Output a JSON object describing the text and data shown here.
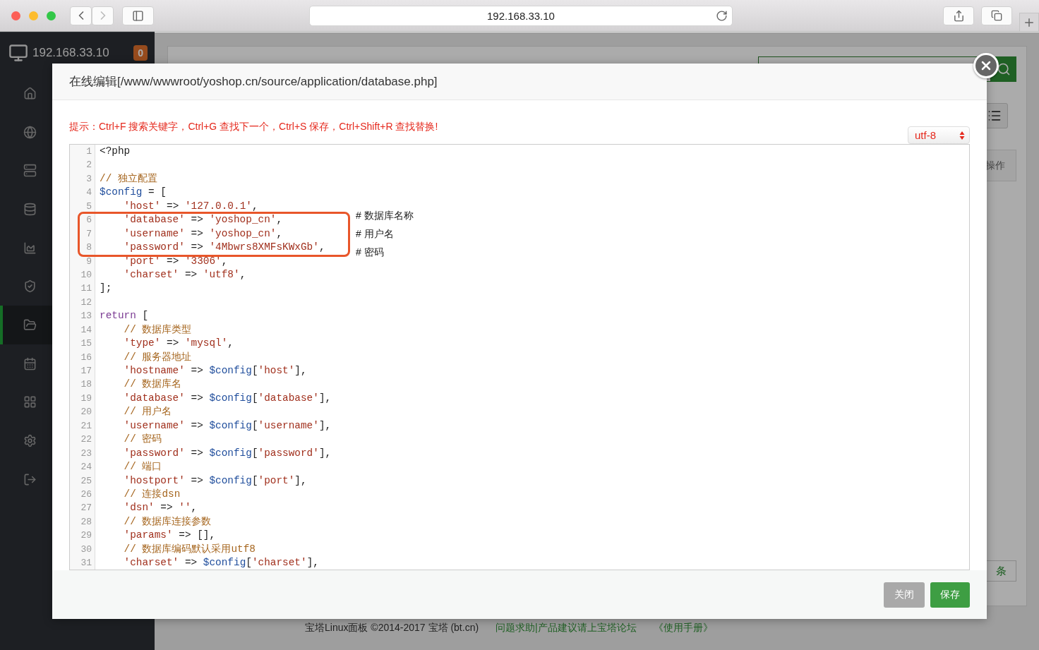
{
  "browser": {
    "url": "192.168.33.10"
  },
  "sidebar": {
    "host": "192.168.33.10",
    "badge": "0",
    "items": [
      {
        "selected": false
      },
      {
        "selected": false
      },
      {
        "selected": false
      },
      {
        "selected": false
      },
      {
        "selected": false
      },
      {
        "selected": false
      },
      {
        "selected": true
      },
      {
        "selected": false
      },
      {
        "selected": false
      },
      {
        "selected": false
      },
      {
        "selected": false
      }
    ]
  },
  "backdrop": {
    "table_header": "操作",
    "pager_button": "条"
  },
  "footer": {
    "copyright": "宝塔Linux面板 ©2014-2017 宝塔 (bt.cn)",
    "links": [
      "问题求助|产品建议请上宝塔论坛",
      "《使用手册》"
    ]
  },
  "dialog": {
    "title": "在线编辑[/www/wwwroot/yoshop.cn/source/application/database.php]",
    "hint": "提示：Ctrl+F 搜索关键字，Ctrl+G 查找下一个，Ctrl+S 保存，Ctrl+Shift+R 查找替换!",
    "encoding": "utf-8",
    "lines": [
      {
        "n": "1",
        "tokens": [
          {
            "kind": "plain",
            "text": "<?php"
          }
        ]
      },
      {
        "n": "2"
      },
      {
        "n": "3",
        "tokens": [
          {
            "kind": "comment",
            "text": "// 独立配置"
          }
        ]
      },
      {
        "n": "4",
        "tokens": [
          {
            "kind": "variable",
            "text": "$config"
          },
          {
            "kind": "plain",
            "text": " = ["
          }
        ]
      },
      {
        "n": "5",
        "indented": true,
        "tokens": [
          {
            "kind": "string",
            "text": "'host'"
          },
          {
            "kind": "plain",
            "text": " => "
          },
          {
            "kind": "string",
            "text": "'127.0.0.1'"
          },
          {
            "kind": "plain",
            "text": ","
          }
        ]
      },
      {
        "n": "6",
        "indented": true,
        "marked": true,
        "tokens": [
          {
            "kind": "string",
            "text": "'database'"
          },
          {
            "kind": "plain",
            "text": " => "
          },
          {
            "kind": "string",
            "text": "'yoshop_cn'"
          },
          {
            "kind": "plain",
            "text": ","
          }
        ]
      },
      {
        "n": "7",
        "indented": true,
        "marked": true,
        "tokens": [
          {
            "kind": "string",
            "text": "'username'"
          },
          {
            "kind": "plain",
            "text": " => "
          },
          {
            "kind": "string",
            "text": "'yoshop_cn'"
          },
          {
            "kind": "plain",
            "text": ","
          }
        ]
      },
      {
        "n": "8",
        "indented": true,
        "marked": true,
        "tokens": [
          {
            "kind": "string",
            "text": "'password'"
          },
          {
            "kind": "plain",
            "text": " => "
          },
          {
            "kind": "string",
            "text": "'4Mbwrs8XMFsKWxGb'"
          },
          {
            "kind": "plain",
            "text": ","
          }
        ]
      },
      {
        "n": "9",
        "indented": true,
        "tokens": [
          {
            "kind": "string",
            "text": "'port'"
          },
          {
            "kind": "plain",
            "text": " => "
          },
          {
            "kind": "string",
            "text": "'3306'"
          },
          {
            "kind": "plain",
            "text": ","
          }
        ]
      },
      {
        "n": "10",
        "indented": true,
        "tokens": [
          {
            "kind": "string",
            "text": "'charset'"
          },
          {
            "kind": "plain",
            "text": " => "
          },
          {
            "kind": "string",
            "text": "'utf8'"
          },
          {
            "kind": "plain",
            "text": ","
          }
        ]
      },
      {
        "n": "11",
        "tokens": [
          {
            "kind": "plain",
            "text": "];"
          }
        ]
      },
      {
        "n": "12"
      },
      {
        "n": "13",
        "tokens": [
          {
            "kind": "keyword",
            "text": "return"
          },
          {
            "kind": "plain",
            "text": " ["
          }
        ]
      },
      {
        "n": "14",
        "indented": true,
        "tokens": [
          {
            "kind": "comment",
            "text": "// 数据库类型"
          }
        ]
      },
      {
        "n": "15",
        "indented": true,
        "tokens": [
          {
            "kind": "string",
            "text": "'type'"
          },
          {
            "kind": "plain",
            "text": " => "
          },
          {
            "kind": "string",
            "text": "'mysql'"
          },
          {
            "kind": "plain",
            "text": ","
          }
        ]
      },
      {
        "n": "16",
        "indented": true,
        "tokens": [
          {
            "kind": "comment",
            "text": "// 服务器地址"
          }
        ]
      },
      {
        "n": "17",
        "indented": true,
        "tokens": [
          {
            "kind": "string",
            "text": "'hostname'"
          },
          {
            "kind": "plain",
            "text": " => "
          },
          {
            "kind": "variable",
            "text": "$config"
          },
          {
            "kind": "plain",
            "text": "["
          },
          {
            "kind": "string",
            "text": "'host'"
          },
          {
            "kind": "plain",
            "text": "],"
          }
        ]
      },
      {
        "n": "18",
        "indented": true,
        "tokens": [
          {
            "kind": "comment",
            "text": "// 数据库名"
          }
        ]
      },
      {
        "n": "19",
        "indented": true,
        "tokens": [
          {
            "kind": "string",
            "text": "'database'"
          },
          {
            "kind": "plain",
            "text": " => "
          },
          {
            "kind": "variable",
            "text": "$config"
          },
          {
            "kind": "plain",
            "text": "["
          },
          {
            "kind": "string",
            "text": "'database'"
          },
          {
            "kind": "plain",
            "text": "],"
          }
        ]
      },
      {
        "n": "20",
        "indented": true,
        "tokens": [
          {
            "kind": "comment",
            "text": "// 用户名"
          }
        ]
      },
      {
        "n": "21",
        "indented": true,
        "tokens": [
          {
            "kind": "string",
            "text": "'username'"
          },
          {
            "kind": "plain",
            "text": " => "
          },
          {
            "kind": "variable",
            "text": "$config"
          },
          {
            "kind": "plain",
            "text": "["
          },
          {
            "kind": "string",
            "text": "'username'"
          },
          {
            "kind": "plain",
            "text": "],"
          }
        ]
      },
      {
        "n": "22",
        "indented": true,
        "tokens": [
          {
            "kind": "comment",
            "text": "// 密码"
          }
        ]
      },
      {
        "n": "23",
        "indented": true,
        "tokens": [
          {
            "kind": "string",
            "text": "'password'"
          },
          {
            "kind": "plain",
            "text": " => "
          },
          {
            "kind": "variable",
            "text": "$config"
          },
          {
            "kind": "plain",
            "text": "["
          },
          {
            "kind": "string",
            "text": "'password'"
          },
          {
            "kind": "plain",
            "text": "],"
          }
        ]
      },
      {
        "n": "24",
        "indented": true,
        "tokens": [
          {
            "kind": "comment",
            "text": "// 端口"
          }
        ]
      },
      {
        "n": "25",
        "indented": true,
        "tokens": [
          {
            "kind": "string",
            "text": "'hostport'"
          },
          {
            "kind": "plain",
            "text": " => "
          },
          {
            "kind": "variable",
            "text": "$config"
          },
          {
            "kind": "plain",
            "text": "["
          },
          {
            "kind": "string",
            "text": "'port'"
          },
          {
            "kind": "plain",
            "text": "],"
          }
        ]
      },
      {
        "n": "26",
        "indented": true,
        "tokens": [
          {
            "kind": "comment",
            "text": "// 连接dsn"
          }
        ]
      },
      {
        "n": "27",
        "indented": true,
        "tokens": [
          {
            "kind": "string",
            "text": "'dsn'"
          },
          {
            "kind": "plain",
            "text": " => "
          },
          {
            "kind": "string",
            "text": "''"
          },
          {
            "kind": "plain",
            "text": ","
          }
        ]
      },
      {
        "n": "28",
        "indented": true,
        "tokens": [
          {
            "kind": "comment",
            "text": "// 数据库连接参数"
          }
        ]
      },
      {
        "n": "29",
        "indented": true,
        "tokens": [
          {
            "kind": "string",
            "text": "'params'"
          },
          {
            "kind": "plain",
            "text": " => [],"
          }
        ]
      },
      {
        "n": "30",
        "indented": true,
        "tokens": [
          {
            "kind": "comment",
            "text": "// 数据库编码默认采用utf8"
          }
        ]
      },
      {
        "n": "31",
        "indented": true,
        "tokens": [
          {
            "kind": "string",
            "text": "'charset'"
          },
          {
            "kind": "plain",
            "text": " => "
          },
          {
            "kind": "variable",
            "text": "$config"
          },
          {
            "kind": "plain",
            "text": "["
          },
          {
            "kind": "string",
            "text": "'charset'"
          },
          {
            "kind": "plain",
            "text": "],"
          }
        ]
      }
    ],
    "notes": [
      "# 数据库名称",
      "# 用户名",
      "# 密码"
    ],
    "buttons": [
      {
        "label": "关闭",
        "kind": "secondary"
      },
      {
        "label": "保存",
        "kind": "primary"
      }
    ]
  }
}
